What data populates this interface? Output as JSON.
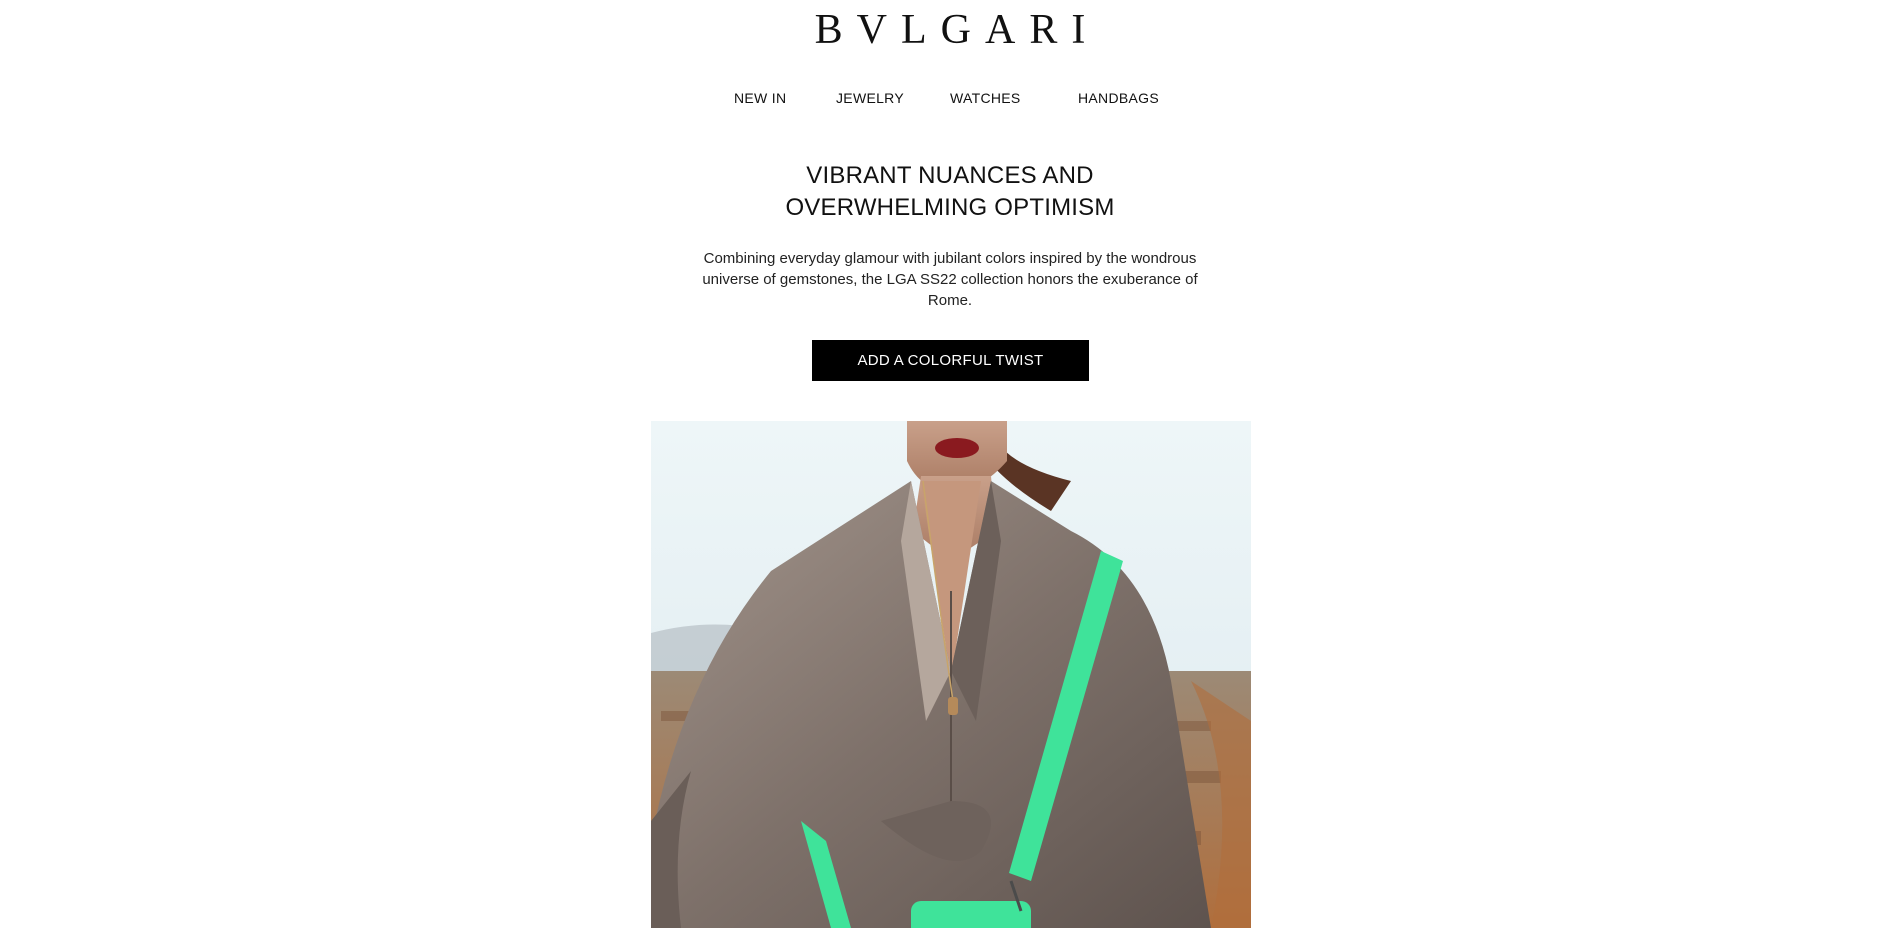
{
  "brand": {
    "logo_text": "BVLGARI"
  },
  "nav": {
    "items": [
      {
        "label": "NEW IN"
      },
      {
        "label": "JEWELRY"
      },
      {
        "label": "WATCHES"
      },
      {
        "label": "HANDBAGS"
      }
    ]
  },
  "hero": {
    "headline_line1": "VIBRANT NUANCES AND",
    "headline_line2": "OVERWHELMING OPTIMISM",
    "description": "Combining everyday glamour with jubilant colors inspired by the wondrous universe of gemstones, the LGA SS22 collection honors the exuberance of Rome.",
    "cta_label": "ADD A COLORFUL TWIST"
  },
  "colors": {
    "cta_background": "#000000",
    "cta_text": "#ffffff",
    "strap_green": "#3fe39a",
    "shirt_taupe": "#8c7f78",
    "sky": "#e9f3f6"
  }
}
